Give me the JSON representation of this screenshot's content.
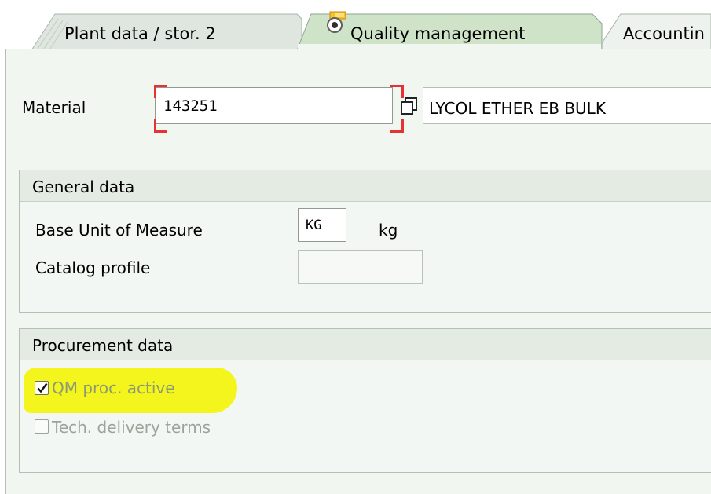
{
  "tabs": [
    {
      "label": "Plant data / stor. 2",
      "active": false
    },
    {
      "label": "Quality management",
      "active": true,
      "icon": "quality-management-icon"
    },
    {
      "label": "Accountin",
      "active": false
    }
  ],
  "material": {
    "label": "Material",
    "value": "143251",
    "description": "LYCOL ETHER EB  BULK",
    "required": true
  },
  "general_data": {
    "title": "General data",
    "base_uom_label": "Base Unit of Measure",
    "base_uom_value": "KG",
    "base_uom_text": "kg",
    "catalog_profile_label": "Catalog profile",
    "catalog_profile_value": ""
  },
  "procurement_data": {
    "title": "Procurement data",
    "qm_proc_active_label": "QM proc. active",
    "qm_proc_active_checked": true,
    "tech_delivery_terms_label": "Tech. delivery terms",
    "tech_delivery_terms_checked": false
  },
  "colors": {
    "panel_bg": "#f1f6f1",
    "group_header_bg": "#e3ebe3",
    "required_marker": "#e53333",
    "highlight": "#f3f51d"
  }
}
